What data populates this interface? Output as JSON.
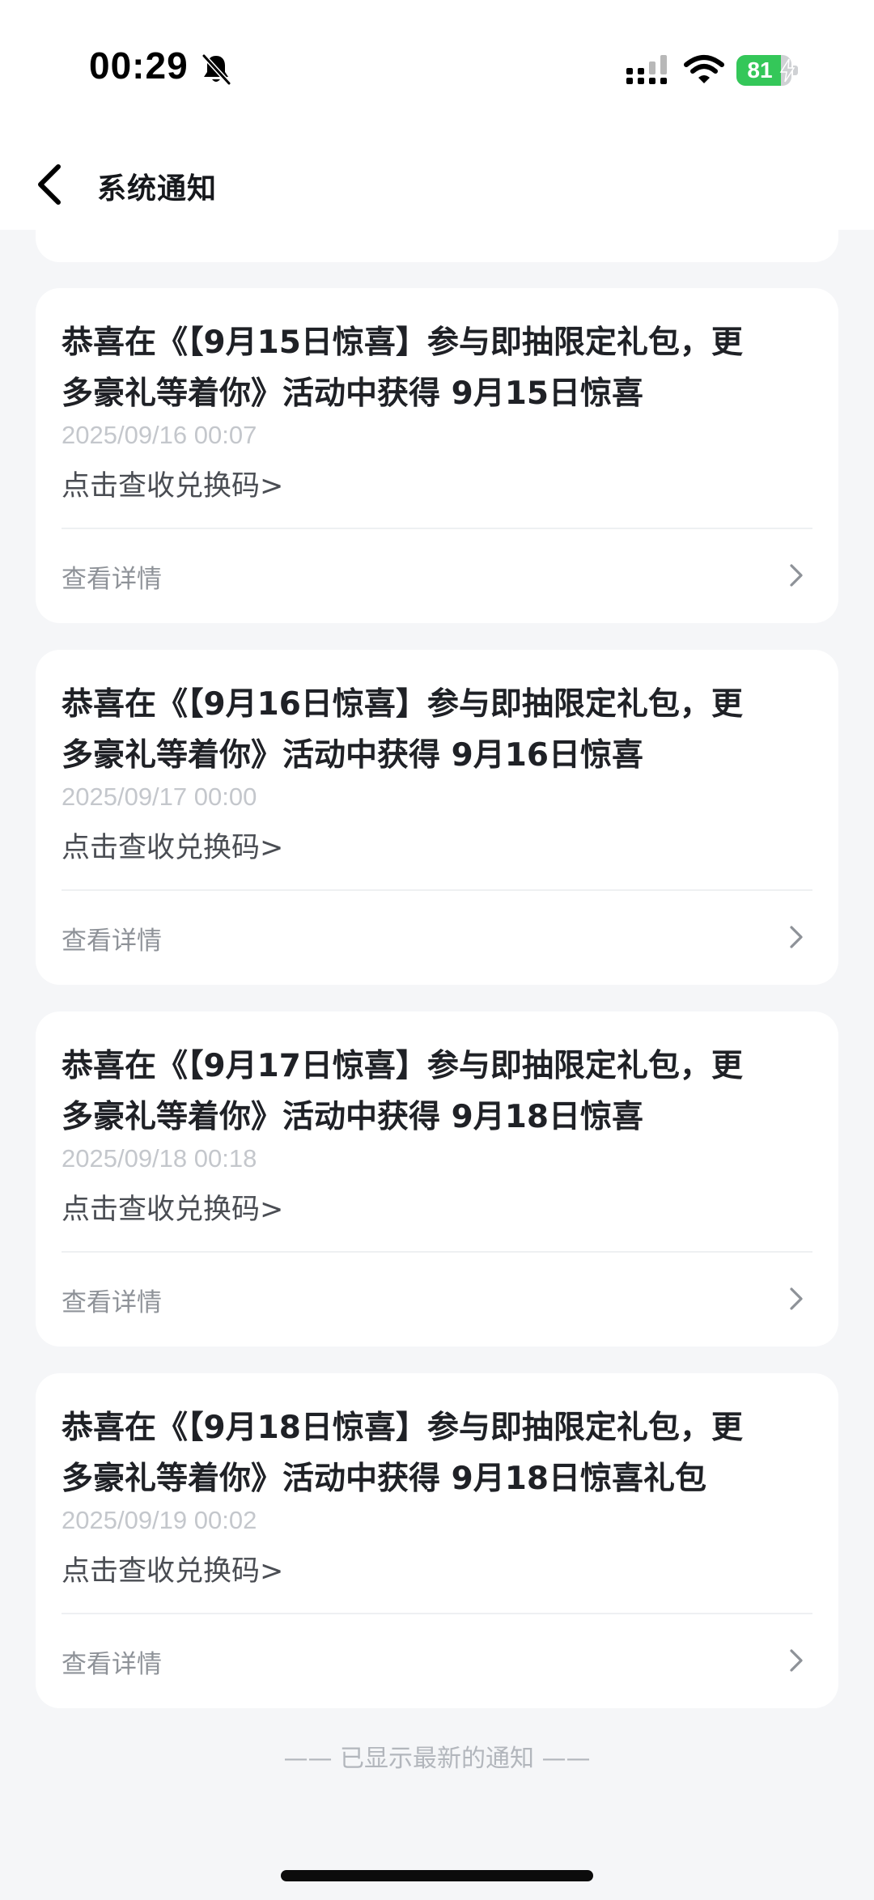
{
  "status_bar": {
    "time": "00:29",
    "battery": "81",
    "battery_level": 0.81,
    "icons": [
      "bell-slash-icon",
      "signal-icon",
      "wifi-icon",
      "battery-icon",
      "charging-bolt-icon"
    ]
  },
  "nav": {
    "title": "系统通知",
    "back_icon": "chevron-left-icon"
  },
  "notifications": [
    {
      "title_line1": "恭喜在《【9月15日惊喜】参与即抽限定礼包，更",
      "title_line2": "多豪礼等着你》活动中获得 9月15日惊喜",
      "time": "2025/09/16 00:07",
      "action": "点击查收兑换码>",
      "detail": "查看详情"
    },
    {
      "title_line1": "恭喜在《【9月16日惊喜】参与即抽限定礼包，更",
      "title_line2": "多豪礼等着你》活动中获得 9月16日惊喜",
      "time": "2025/09/17 00:00",
      "action": "点击查收兑换码>",
      "detail": "查看详情"
    },
    {
      "title_line1": "恭喜在《【9月17日惊喜】参与即抽限定礼包，更",
      "title_line2": "多豪礼等着你》活动中获得 9月18日惊喜",
      "time": "2025/09/18 00:18",
      "action": "点击查收兑换码>",
      "detail": "查看详情"
    },
    {
      "title_line1": "恭喜在《【9月18日惊喜】参与即抽限定礼包，更",
      "title_line2": "多豪礼等着你》活动中获得 9月18日惊喜礼包",
      "time": "2025/09/19 00:02",
      "action": "点击查收兑换码>",
      "detail": "查看详情"
    }
  ],
  "footer": {
    "note": "—— 已显示最新的通知 ——"
  },
  "colors": {
    "background": "#f5f6f8",
    "card": "#ffffff",
    "battery_green": "#34c759",
    "title_text": "#1f2126",
    "muted_text": "#8e9298"
  }
}
